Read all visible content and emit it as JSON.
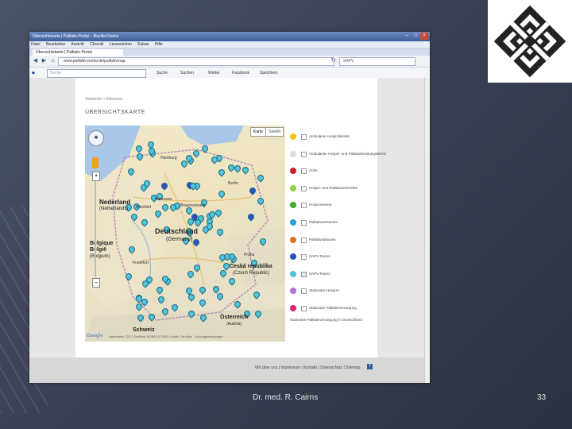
{
  "slide": {
    "footer_text": "Dr. med. R. Cairns",
    "page_number": "33"
  },
  "browser": {
    "window_title": "Übersichtskarte | Palliativ-Portal – Mozilla Firefox",
    "menu": [
      "Datei",
      "Bearbeiten",
      "Ansicht",
      "Chronik",
      "Lesezeichen",
      "Extras",
      "Hilfe"
    ],
    "tab_label": "Übersichtskarte | Palliativ-Portal",
    "url": "www.palliativ-portal.de/palliativmap",
    "search_engine_text": "SAPV",
    "toolbar_search_placeholder": "Suche",
    "toolbar_items": [
      "Suche",
      "Suchen",
      "Wetter",
      "Facebook",
      "Speichern"
    ]
  },
  "page": {
    "breadcrumb": "Startseite » Adressen",
    "heading": "ÜBERSICHTSKARTE",
    "map": {
      "btn_map": "Karte",
      "btn_satellite": "Satellit",
      "copyright": "Kartendaten ©2012 GeoBasis-DE/BKG (©2009), Google, Tele Atlas – Nutzungsbedingungen",
      "labels": [
        {
          "text": "Nederland"
        },
        {
          "text": "(Netherlands)"
        },
        {
          "text": "Deutschland"
        },
        {
          "text": "(Germany)"
        },
        {
          "text": "Belgique"
        },
        {
          "text": "België"
        },
        {
          "text": "(Belgium)"
        },
        {
          "text": "Česká republika"
        },
        {
          "text": "(Czech Republic)"
        },
        {
          "text": "Österreich"
        },
        {
          "text": "(Austria)"
        },
        {
          "text": "Schweiz"
        },
        {
          "text": "Berlin"
        },
        {
          "text": "Hamburg"
        },
        {
          "text": "Hannover"
        },
        {
          "text": "Praha"
        },
        {
          "text": "Bielefeld"
        },
        {
          "text": "Braunschweig"
        },
        {
          "text": "Frankfurt"
        }
      ]
    },
    "legend": [
      {
        "label": "Ambulante Hospizdienste",
        "color": "#f5c400",
        "checked": false
      },
      {
        "label": "Ambulanter Hospiz- und Palliativberatungsdienst",
        "color": "#dcdcdc",
        "checked": false
      },
      {
        "label": "Ärzte",
        "color": "#cc1c1c",
        "checked": false
      },
      {
        "label": "Hospiz- und Palliativnetzwerke",
        "color": "#8fd63a",
        "checked": false
      },
      {
        "label": "Hospizvereine",
        "color": "#3fae2a",
        "checked": false
      },
      {
        "label": "Palliativnetzwerke",
        "color": "#29a0d6",
        "checked": false
      },
      {
        "label": "Palliativstationen",
        "color": "#e8701a",
        "checked": false
      },
      {
        "label": "SAPV-Teams",
        "color": "#2a50c8",
        "checked": false
      },
      {
        "label": "SAPV-Teams",
        "color": "#4fc3d9",
        "checked": true
      },
      {
        "label": "Stationäre Hospize",
        "color": "#b46fd8",
        "checked": false
      },
      {
        "label": "Stationäre Palliativversorgung",
        "color": "#e0206a",
        "checked": false
      }
    ],
    "legend_footer": "Stationäre Palliativversorgung in Deutschland",
    "footer_links": "Wir über uns | Impressum | Kontakt | Datenschutz | Sitemap"
  },
  "colors": {
    "marker_main": "#4fc3d9",
    "marker_alt": "#2a50c8",
    "titlebar": "#4c6ea8"
  }
}
